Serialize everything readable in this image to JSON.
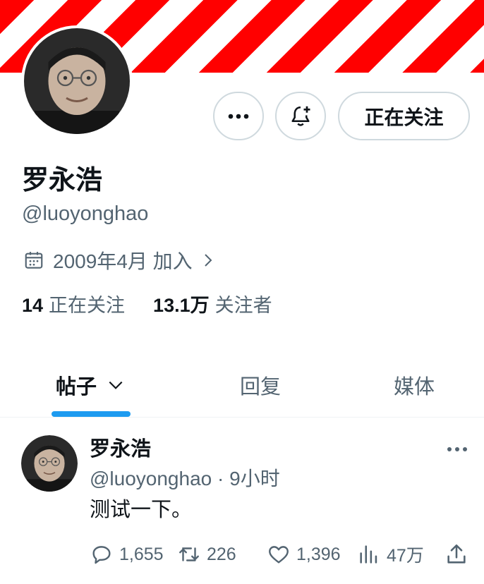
{
  "profile": {
    "name": "罗永浩",
    "handle": "@luoyonghao",
    "joined": "2009年4月 加入",
    "following_count": "14",
    "following_label": "正在关注",
    "followers_count": "13.1万",
    "followers_label": "关注者"
  },
  "actions": {
    "following_button": "正在关注",
    "more_icon": "more-horizontal-icon",
    "notify_icon": "bell-plus-icon"
  },
  "tabs": [
    {
      "label": "帖子",
      "active": true
    },
    {
      "label": "回复",
      "active": false
    },
    {
      "label": "媒体",
      "active": false
    }
  ],
  "post": {
    "author_name": "罗永浩",
    "author_handle": "@luoyonghao",
    "separator": "·",
    "time": "9小时",
    "text": "测试一下。",
    "replies": "1,655",
    "retweets": "226",
    "likes": "1,396",
    "views": "47万"
  },
  "colors": {
    "accent": "#1d9bf0",
    "banner_red": "#ff0000",
    "text_primary": "#0f1419",
    "text_secondary": "#536471",
    "border": "#cfd9de"
  }
}
